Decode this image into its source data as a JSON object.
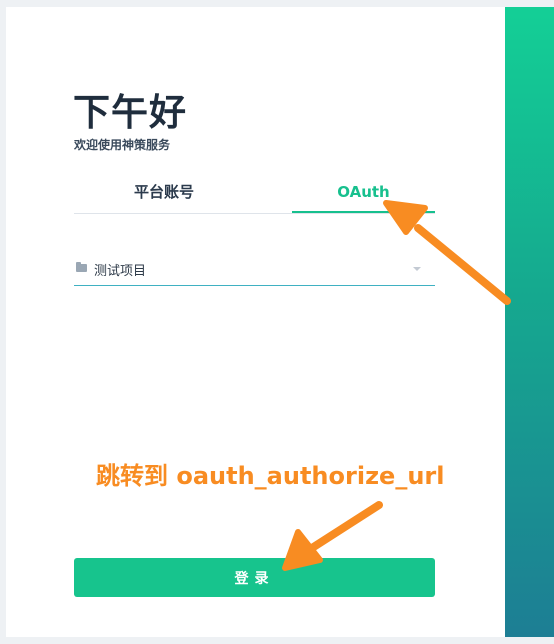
{
  "greeting": "下午好",
  "subtitle": "欢迎使用神策服务",
  "tabs": [
    {
      "label": "平台账号",
      "active": false
    },
    {
      "label": "OAuth",
      "active": true
    }
  ],
  "project_select": {
    "icon": "folder-icon",
    "value": "测试项目"
  },
  "login_button": "登录",
  "annotation": "跳转到 oauth_authorize_url",
  "colors": {
    "accent": "#17c08e",
    "button": "#17c48d",
    "annotation": "#f88c22",
    "gradient_top": "#14cf96",
    "gradient_bottom": "#1d7e94"
  }
}
